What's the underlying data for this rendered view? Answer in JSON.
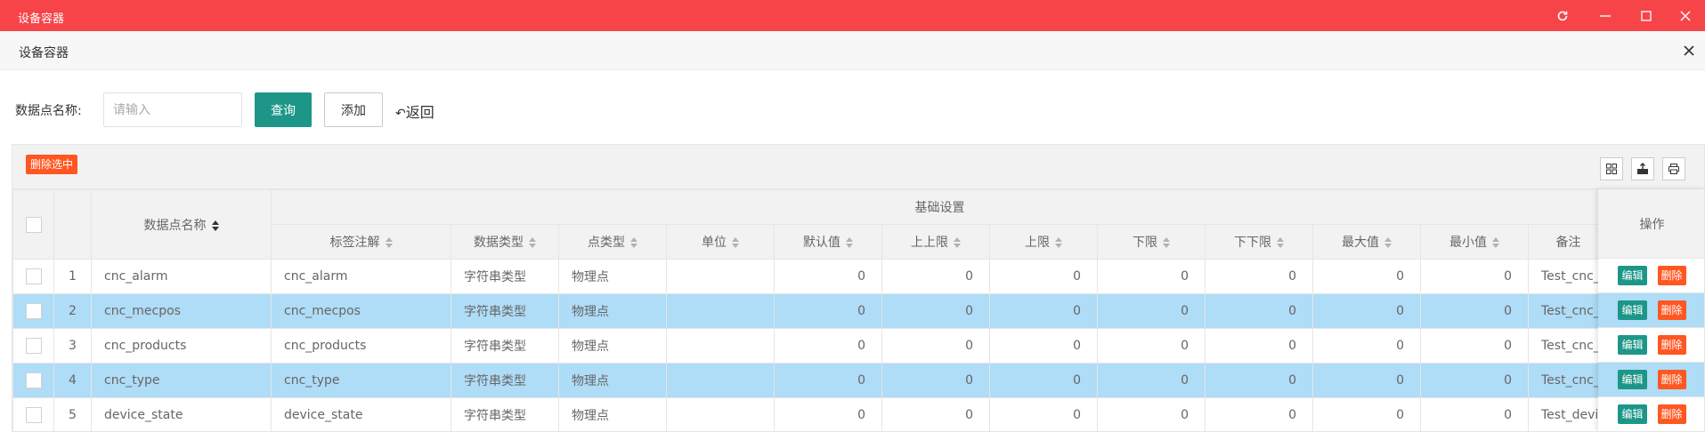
{
  "window": {
    "title": "设备容器",
    "controls": [
      "refresh-icon",
      "minimize-icon",
      "maximize-icon",
      "close-icon"
    ]
  },
  "header": {
    "title": "设备容器"
  },
  "search": {
    "label": "数据点名称:",
    "placeholder": "请输入",
    "value": "",
    "query_label": "查询",
    "add_label": "添加",
    "back_label": "返回"
  },
  "toolbar": {
    "delete_selected_label": "删除选中",
    "icons": [
      "grid-columns-icon",
      "export-icon",
      "print-icon"
    ]
  },
  "table": {
    "group_header": "基础设置",
    "name_header": "数据点名称",
    "columns": [
      "标签注解",
      "数据类型",
      "点类型",
      "单位",
      "默认值",
      "上上限",
      "上限",
      "下限",
      "下下限",
      "最大值",
      "最小值",
      "备注"
    ],
    "op_header": "操作",
    "edit_label": "编辑",
    "delete_label": "删除",
    "rows": [
      {
        "idx": "1",
        "name": "cnc_alarm",
        "label": "cnc_alarm",
        "dtype": "字符串类型",
        "ptype": "物理点",
        "unit": "",
        "default": "0",
        "hh": "0",
        "h": "0",
        "l": "0",
        "ll": "0",
        "max": "0",
        "min": "0",
        "note": "Test_cnc_",
        "selected": false
      },
      {
        "idx": "2",
        "name": "cnc_mecpos",
        "label": "cnc_mecpos",
        "dtype": "字符串类型",
        "ptype": "物理点",
        "unit": "",
        "default": "0",
        "hh": "0",
        "h": "0",
        "l": "0",
        "ll": "0",
        "max": "0",
        "min": "0",
        "note": "Test_cnc_",
        "selected": true
      },
      {
        "idx": "3",
        "name": "cnc_products",
        "label": "cnc_products",
        "dtype": "字符串类型",
        "ptype": "物理点",
        "unit": "",
        "default": "0",
        "hh": "0",
        "h": "0",
        "l": "0",
        "ll": "0",
        "max": "0",
        "min": "0",
        "note": "Test_cnc_",
        "selected": false
      },
      {
        "idx": "4",
        "name": "cnc_type",
        "label": "cnc_type",
        "dtype": "字符串类型",
        "ptype": "物理点",
        "unit": "",
        "default": "0",
        "hh": "0",
        "h": "0",
        "l": "0",
        "ll": "0",
        "max": "0",
        "min": "0",
        "note": "Test_cnc_",
        "selected": true
      },
      {
        "idx": "5",
        "name": "device_state",
        "label": "device_state",
        "dtype": "字符串类型",
        "ptype": "物理点",
        "unit": "",
        "default": "0",
        "hh": "0",
        "h": "0",
        "l": "0",
        "ll": "0",
        "max": "0",
        "min": "0",
        "note": "Test_devic",
        "selected": false
      }
    ]
  },
  "colors": {
    "titlebar": "#f64448",
    "primary": "#1d9688",
    "danger": "#ff5722",
    "row_selected": "#afdcf6"
  }
}
